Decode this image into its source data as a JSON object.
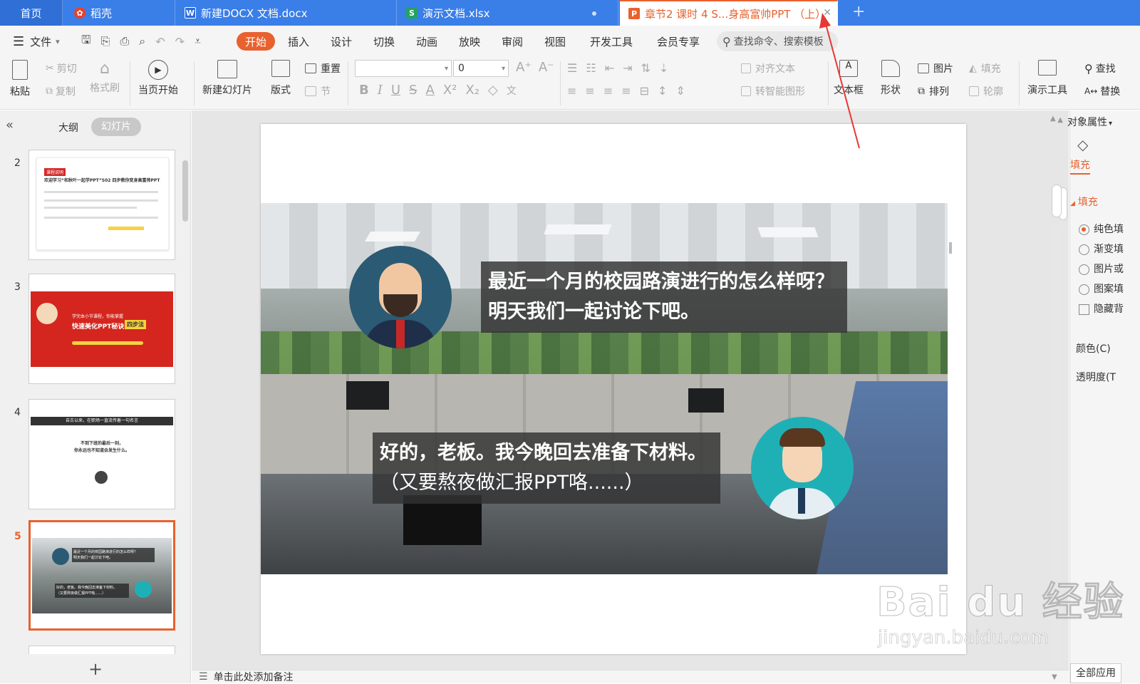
{
  "tabs": [
    {
      "label": "首页",
      "icon": "home-tab"
    },
    {
      "label": "稻壳",
      "icon": "docer-logo-icon"
    },
    {
      "label": "新建DOCX 文档.docx",
      "icon": "writer-doc-icon",
      "icon_text": "W"
    },
    {
      "label": "演示文档.xlsx",
      "icon": "spreadsheet-doc-icon",
      "icon_text": "S"
    },
    {
      "label": "章节2 课时 4 S...身高富帅PPT （上）",
      "icon": "presentation-doc-icon",
      "icon_text": "P"
    }
  ],
  "new_tab_symbol": "+",
  "close_tab_symbol": "✕",
  "menu": {
    "file_label": "文件",
    "items": [
      "开始",
      "插入",
      "设计",
      "切换",
      "动画",
      "放映",
      "审阅",
      "视图",
      "开发工具",
      "会员专享"
    ],
    "active": "开始",
    "search_placeholder": "查找命令、搜索模板"
  },
  "ribbon": {
    "paste": "粘贴",
    "cut": "剪切",
    "copy": "复制",
    "format_painter": "格式刷",
    "play_from_current": "当页开始",
    "new_slide": "新建幻灯片",
    "layout": "版式",
    "reset": "重置",
    "section": "节",
    "font_size": "0",
    "align_text": "对齐文本",
    "convert_smartart": "转智能图形",
    "textbox": "文本框",
    "shape": "形状",
    "picture": "图片",
    "fill": "填充",
    "arrange": "排列",
    "outline": "轮廓",
    "presentation_tools": "演示工具",
    "find": "查找",
    "replace": "替换"
  },
  "left_panel": {
    "collapse_symbol": "«",
    "outline_tab": "大纲",
    "slides_tab": "幻灯片",
    "slide_numbers": [
      "2",
      "3",
      "4",
      "5"
    ],
    "selected_slide": "5",
    "add_symbol": "+"
  },
  "thumb2": {
    "tag": "课程说明",
    "title": "欢迎学习“和秋叶一起学PPT”S02 四步教你变身高富帅PPT"
  },
  "thumb3": {
    "line1": "学完本小节课程，你能掌握",
    "line2": "快速美化PPT秘诀",
    "badge": "四步法"
  },
  "thumb4": {
    "banner": "自古以来，在职场一直流传着一句名言",
    "line1": "不到下班的最后一刻，",
    "line2": "你永远也不知道会发生什么。"
  },
  "thumb5": {
    "q": "最近一个月的校园路演进行的怎么样呀？",
    "q2": "明天我们一起讨论下吧。",
    "a": "好的，老板。我今晚回去准备下材料。",
    "a2": "（又要熬夜做汇报PPT咯……）"
  },
  "slide": {
    "boss_line1": "最近一个月的校园路演进行的怎么样呀？",
    "boss_line2": "明天我们一起讨论下吧。",
    "employee_line1": "好的，老板。我今晚回去准备下材料。",
    "employee_line2": "（又要熬夜做汇报PPT咯......）"
  },
  "notes_placeholder": "单击此处添加备注",
  "right_panel": {
    "title": "对象属性",
    "tab": "填充",
    "section": "填充",
    "options": [
      "纯色填",
      "渐变填",
      "图片或",
      "图案填"
    ],
    "selected": "纯色填",
    "hide_bg": "隐藏背",
    "color_label": "颜色(C)",
    "transparency_label": "透明度(T",
    "apply_all": "全部应用"
  },
  "watermark": {
    "brand": "Bai du 经验",
    "url": "jingyan.baidu.com"
  },
  "colors": {
    "accent": "#e8612e",
    "tabbar": "#3a7ee8",
    "annotation_arrow": "#e53935"
  }
}
